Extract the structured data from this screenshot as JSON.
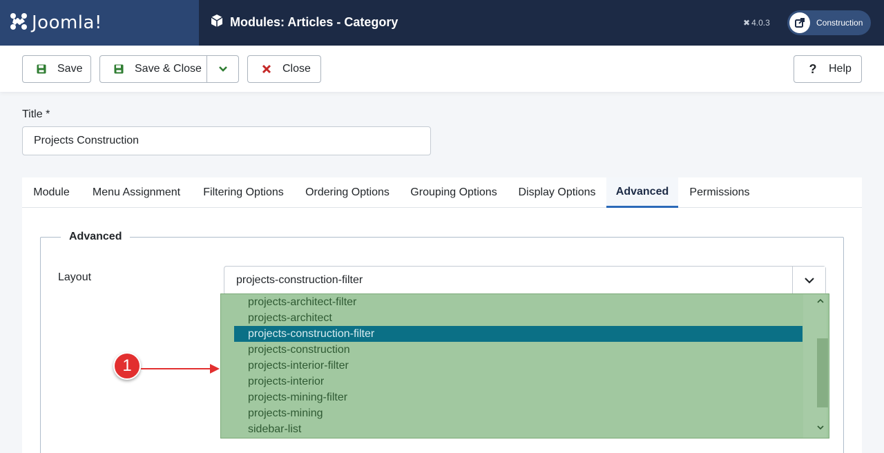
{
  "header": {
    "brand": "Joomla!",
    "page_title": "Modules: Articles - Category",
    "version": "4.0.3",
    "site_button": "Construction"
  },
  "toolbar": {
    "save": "Save",
    "save_close": "Save & Close",
    "close": "Close",
    "help": "Help"
  },
  "form": {
    "title_label": "Title *",
    "title_value": "Projects Construction"
  },
  "tabs": [
    "Module",
    "Menu Assignment",
    "Filtering Options",
    "Ordering Options",
    "Grouping Options",
    "Display Options",
    "Advanced",
    "Permissions"
  ],
  "active_tab": "Advanced",
  "advanced": {
    "legend": "Advanced",
    "layout_label": "Layout",
    "layout_value": "projects-construction-filter",
    "options": [
      "projects-architect-filter",
      "projects-architect",
      "projects-construction-filter",
      "projects-construction",
      "projects-interior-filter",
      "projects-interior",
      "projects-mining-filter",
      "projects-mining",
      "sidebar-list"
    ],
    "selected_option": "projects-construction-filter"
  },
  "callout": {
    "number": "1"
  },
  "colors": {
    "header_bg": "#1c2a45",
    "brand_bg": "#2b4673",
    "highlight_overlay": "#a1c8a0",
    "selected_option": "#0b7086",
    "callout_red": "#e22f2f",
    "save_green": "#2f7d32",
    "close_red": "#c52827"
  }
}
